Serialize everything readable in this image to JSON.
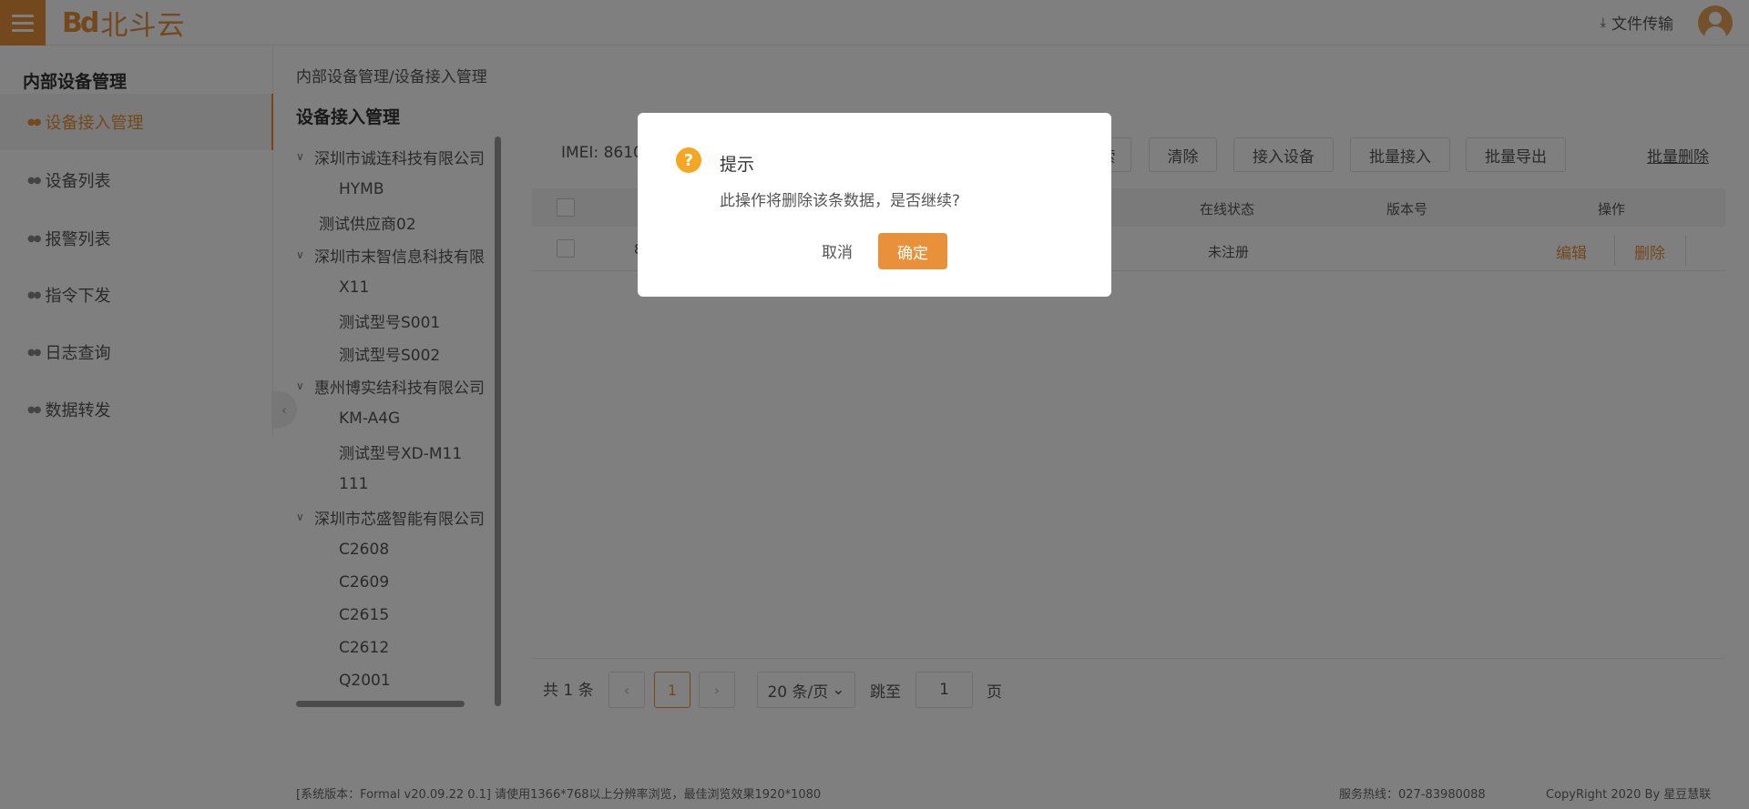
{
  "header": {
    "logo_mark": "Bd",
    "logo_text": "北斗云",
    "file_transfer": "文件传输"
  },
  "sidebar": {
    "title": "内部设备管理",
    "items": [
      {
        "label": "设备接入管理",
        "active": true
      },
      {
        "label": "设备列表"
      },
      {
        "label": "报警列表"
      },
      {
        "label": "指令下发"
      },
      {
        "label": "日志查询"
      },
      {
        "label": "数据转发"
      }
    ]
  },
  "breadcrumb": "内部设备管理/设备接入管理",
  "page_title": "设备接入管理",
  "tree": [
    {
      "label": "深圳市诚连科技有限公司",
      "level": 0,
      "expanded": true
    },
    {
      "label": "HYMB",
      "level": 1
    },
    {
      "label": "测试供应商02",
      "level": 0
    },
    {
      "label": "深圳市末智信息科技有限",
      "level": 0,
      "expanded": true
    },
    {
      "label": "X11",
      "level": 1
    },
    {
      "label": "测试型号S001",
      "level": 1
    },
    {
      "label": "测试型号S002",
      "level": 1
    },
    {
      "label": "惠州博实结科技有限公司",
      "level": 0,
      "expanded": true
    },
    {
      "label": "KM-A4G",
      "level": 1
    },
    {
      "label": "测试型号XD-M11",
      "level": 1
    },
    {
      "label": "111",
      "level": 1
    },
    {
      "label": "深圳市芯盛智能有限公司",
      "level": 0,
      "expanded": true
    },
    {
      "label": "C2608",
      "level": 1
    },
    {
      "label": "C2609",
      "level": 1
    },
    {
      "label": "C2615",
      "level": 1
    },
    {
      "label": "C2612",
      "level": 1
    },
    {
      "label": "Q2001",
      "level": 1
    }
  ],
  "toolbar": {
    "imei_label": "IMEI: 8610",
    "search_partial": "索",
    "clear": "清除",
    "connect_device": "接入设备",
    "batch_connect": "批量接入",
    "batch_export": "批量导出",
    "batch_delete": "批量删除"
  },
  "table": {
    "headers": {
      "online_status": "在线状态",
      "version": "版本号",
      "operation": "操作"
    },
    "rows": [
      {
        "partial": "8",
        "online_status": "未注册",
        "version": "",
        "edit": "编辑",
        "delete": "删除"
      }
    ]
  },
  "pagination": {
    "total": "共 1 条",
    "prev": "‹",
    "current_page": "1",
    "next": "›",
    "page_size": "20 条/页",
    "jump_label": "跳至",
    "jump_value": "1",
    "page_suffix": "页"
  },
  "footer": {
    "version": "[系统版本：Formal v20.09.22 0.1]    请使用1366*768以上分辨率浏览，最佳浏览效果1920*1080",
    "hotline": "服务热线：027-83980088",
    "copyright": "CopyRight 2020 By 星豆慧联"
  },
  "modal": {
    "icon": "?",
    "title": "提示",
    "message": "此操作将删除该条数据，是否继续?",
    "cancel": "取消",
    "confirm": "确定"
  },
  "colors": {
    "accent": "#e8913a",
    "warning_icon": "#f5a623"
  }
}
